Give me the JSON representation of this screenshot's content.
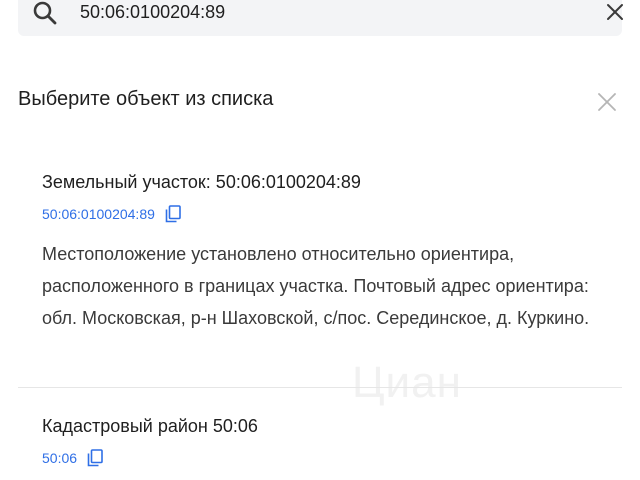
{
  "search": {
    "value": "50:06:0100204:89",
    "search_icon": "search-icon",
    "clear_icon": "close-icon"
  },
  "panel": {
    "title": "Выберите объект из списка",
    "close_icon": "close-icon"
  },
  "results": [
    {
      "title": "Земельный участок: 50:06:0100204:89",
      "code": "50:06:0100204:89",
      "copy_icon": "copy-icon",
      "description": "Местоположение установлено относительно ориентира, расположенного в границах участка. Почтовый адрес ориентира: обл. Московская, р-н Шаховской, с/пос. Серединское, д. Куркино."
    },
    {
      "title": "Кадастровый район 50:06",
      "code": "50:06",
      "copy_icon": "copy-icon"
    }
  ],
  "watermark": "Циан",
  "colors": {
    "accent": "#2f6fe6",
    "search_bg": "#f3f4f6",
    "text": "#1f1f1f",
    "muted_icon": "#b5b5b5",
    "divider": "#e6e6e6"
  }
}
